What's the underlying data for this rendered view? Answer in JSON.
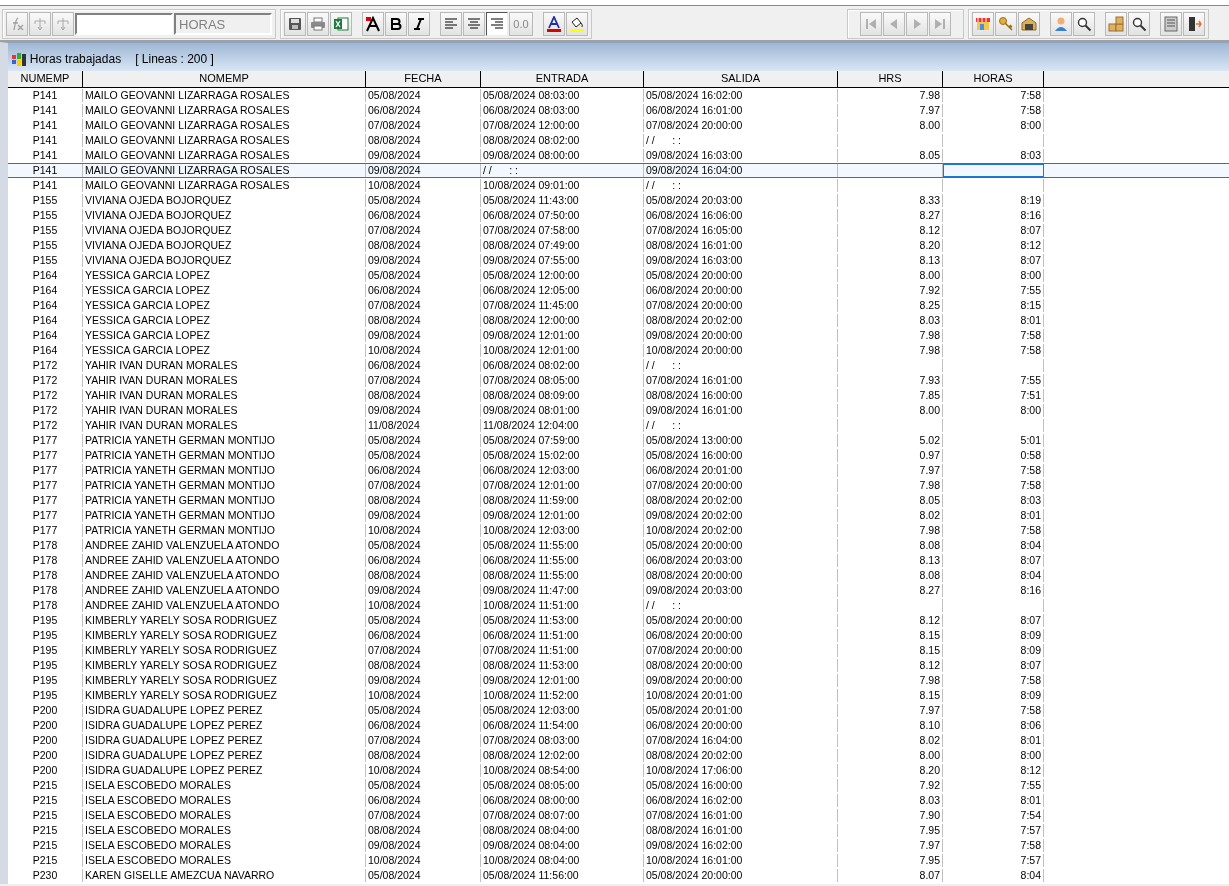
{
  "toolbar": {
    "function_buttons": [
      {
        "disabled": true
      },
      {
        "disabled": true
      },
      {
        "disabled": true
      }
    ],
    "table_field": {
      "value": "HORAS"
    },
    "alignment_buttons": [
      {
        "selected": false
      },
      {
        "selected": false
      },
      {
        "selected": true
      }
    ],
    "precision_button": {
      "label": "0.0",
      "disabled": true
    },
    "nav_buttons": [
      {
        "disabled": true
      },
      {
        "disabled": true
      },
      {
        "disabled": true
      },
      {
        "disabled": true
      }
    ]
  },
  "window": {
    "title": "Horas trabajadas",
    "line_count": "[ Lineas : 200 ]"
  },
  "table": {
    "columns": [
      "NUMEMP",
      "NOMEMP",
      "FECHA",
      "ENTRADA",
      "SALIDA",
      "HRS",
      "HORAS"
    ],
    "rows": [
      {
        "selected": false,
        "cells": [
          "P141",
          "MAILO GEOVANNI LIZARRAGA ROSALES",
          "05/08/2024",
          "05/08/2024 08:03:00",
          "05/08/2024 16:02:00",
          "7.98",
          "7:58"
        ]
      },
      {
        "selected": false,
        "cells": [
          "P141",
          "MAILO GEOVANNI LIZARRAGA ROSALES",
          "06/08/2024",
          "06/08/2024 08:03:00",
          "06/08/2024 16:01:00",
          "7.97",
          "7:58"
        ]
      },
      {
        "selected": false,
        "cells": [
          "P141",
          "MAILO GEOVANNI LIZARRAGA ROSALES",
          "07/08/2024",
          "07/08/2024 12:00:00",
          "07/08/2024 20:00:00",
          "8.00",
          "8:00"
        ]
      },
      {
        "selected": false,
        "cells": [
          "P141",
          "MAILO GEOVANNI LIZARRAGA ROSALES",
          "08/08/2024",
          "08/08/2024 08:02:00",
          "/ /      : :"
        ]
      },
      {
        "selected": false,
        "cells": [
          "P141",
          "MAILO GEOVANNI LIZARRAGA ROSALES",
          "09/08/2024",
          "09/08/2024 08:00:00",
          "09/08/2024 16:03:00",
          "8.05",
          "8:03"
        ]
      },
      {
        "selected": true,
        "cells": [
          "P141",
          "MAILO GEOVANNI LIZARRAGA ROSALES",
          "09/08/2024",
          "/ /      : :",
          "09/08/2024 16:04:00"
        ]
      },
      {
        "selected": false,
        "cells": [
          "P141",
          "MAILO GEOVANNI LIZARRAGA ROSALES",
          "10/08/2024",
          "10/08/2024 09:01:00",
          "/ /      : :"
        ]
      },
      {
        "selected": false,
        "cells": [
          "P155",
          "VIVIANA OJEDA BOJORQUEZ",
          "05/08/2024",
          "05/08/2024 11:43:00",
          "05/08/2024 20:03:00",
          "8.33",
          "8:19"
        ]
      },
      {
        "selected": false,
        "cells": [
          "P155",
          "VIVIANA OJEDA BOJORQUEZ",
          "06/08/2024",
          "06/08/2024 07:50:00",
          "06/08/2024 16:06:00",
          "8.27",
          "8:16"
        ]
      },
      {
        "selected": false,
        "cells": [
          "P155",
          "VIVIANA OJEDA BOJORQUEZ",
          "07/08/2024",
          "07/08/2024 07:58:00",
          "07/08/2024 16:05:00",
          "8.12",
          "8:07"
        ]
      },
      {
        "selected": false,
        "cells": [
          "P155",
          "VIVIANA OJEDA BOJORQUEZ",
          "08/08/2024",
          "08/08/2024 07:49:00",
          "08/08/2024 16:01:00",
          "8.20",
          "8:12"
        ]
      },
      {
        "selected": false,
        "cells": [
          "P155",
          "VIVIANA OJEDA BOJORQUEZ",
          "09/08/2024",
          "09/08/2024 07:55:00",
          "09/08/2024 16:03:00",
          "8.13",
          "8:07"
        ]
      },
      {
        "selected": false,
        "cells": [
          "P164",
          "YESSICA GARCIA LOPEZ",
          "05/08/2024",
          "05/08/2024 12:00:00",
          "05/08/2024 20:00:00",
          "8.00",
          "8:00"
        ]
      },
      {
        "selected": false,
        "cells": [
          "P164",
          "YESSICA GARCIA LOPEZ",
          "06/08/2024",
          "06/08/2024 12:05:00",
          "06/08/2024 20:00:00",
          "7.92",
          "7:55"
        ]
      },
      {
        "selected": false,
        "cells": [
          "P164",
          "YESSICA GARCIA LOPEZ",
          "07/08/2024",
          "07/08/2024 11:45:00",
          "07/08/2024 20:00:00",
          "8.25",
          "8:15"
        ]
      },
      {
        "selected": false,
        "cells": [
          "P164",
          "YESSICA GARCIA LOPEZ",
          "08/08/2024",
          "08/08/2024 12:00:00",
          "08/08/2024 20:02:00",
          "8.03",
          "8:01"
        ]
      },
      {
        "selected": false,
        "cells": [
          "P164",
          "YESSICA GARCIA LOPEZ",
          "09/08/2024",
          "09/08/2024 12:01:00",
          "09/08/2024 20:00:00",
          "7.98",
          "7:58"
        ]
      },
      {
        "selected": false,
        "cells": [
          "P164",
          "YESSICA GARCIA LOPEZ",
          "10/08/2024",
          "10/08/2024 12:01:00",
          "10/08/2024 20:00:00",
          "7.98",
          "7:58"
        ]
      },
      {
        "selected": false,
        "cells": [
          "P172",
          "YAHIR IVAN DURAN MORALES",
          "06/08/2024",
          "06/08/2024 08:02:00",
          "/ /      : :"
        ]
      },
      {
        "selected": false,
        "cells": [
          "P172",
          "YAHIR IVAN DURAN MORALES",
          "07/08/2024",
          "07/08/2024 08:05:00",
          "07/08/2024 16:01:00",
          "7.93",
          "7:55"
        ]
      },
      {
        "selected": false,
        "cells": [
          "P172",
          "YAHIR IVAN DURAN MORALES",
          "08/08/2024",
          "08/08/2024 08:09:00",
          "08/08/2024 16:00:00",
          "7.85",
          "7:51"
        ]
      },
      {
        "selected": false,
        "cells": [
          "P172",
          "YAHIR IVAN DURAN MORALES",
          "09/08/2024",
          "09/08/2024 08:01:00",
          "09/08/2024 16:01:00",
          "8.00",
          "8:00"
        ]
      },
      {
        "selected": false,
        "cells": [
          "P172",
          "YAHIR IVAN DURAN MORALES",
          "11/08/2024",
          "11/08/2024 12:04:00",
          "/ /      : :"
        ]
      },
      {
        "selected": false,
        "cells": [
          "P177",
          "PATRICIA YANETH GERMAN MONTIJO",
          "05/08/2024",
          "05/08/2024 07:59:00",
          "05/08/2024 13:00:00",
          "5.02",
          "5:01"
        ]
      },
      {
        "selected": false,
        "cells": [
          "P177",
          "PATRICIA YANETH GERMAN MONTIJO",
          "05/08/2024",
          "05/08/2024 15:02:00",
          "05/08/2024 16:00:00",
          "0.97",
          "0:58"
        ]
      },
      {
        "selected": false,
        "cells": [
          "P177",
          "PATRICIA YANETH GERMAN MONTIJO",
          "06/08/2024",
          "06/08/2024 12:03:00",
          "06/08/2024 20:01:00",
          "7.97",
          "7:58"
        ]
      },
      {
        "selected": false,
        "cells": [
          "P177",
          "PATRICIA YANETH GERMAN MONTIJO",
          "07/08/2024",
          "07/08/2024 12:01:00",
          "07/08/2024 20:00:00",
          "7.98",
          "7:58"
        ]
      },
      {
        "selected": false,
        "cells": [
          "P177",
          "PATRICIA YANETH GERMAN MONTIJO",
          "08/08/2024",
          "08/08/2024 11:59:00",
          "08/08/2024 20:02:00",
          "8.05",
          "8:03"
        ]
      },
      {
        "selected": false,
        "cells": [
          "P177",
          "PATRICIA YANETH GERMAN MONTIJO",
          "09/08/2024",
          "09/08/2024 12:01:00",
          "09/08/2024 20:02:00",
          "8.02",
          "8:01"
        ]
      },
      {
        "selected": false,
        "cells": [
          "P177",
          "PATRICIA YANETH GERMAN MONTIJO",
          "10/08/2024",
          "10/08/2024 12:03:00",
          "10/08/2024 20:02:00",
          "7.98",
          "7:58"
        ]
      },
      {
        "selected": false,
        "cells": [
          "P178",
          "ANDREE ZAHID VALENZUELA ATONDO",
          "05/08/2024",
          "05/08/2024 11:55:00",
          "05/08/2024 20:00:00",
          "8.08",
          "8:04"
        ]
      },
      {
        "selected": false,
        "cells": [
          "P178",
          "ANDREE ZAHID VALENZUELA ATONDO",
          "06/08/2024",
          "06/08/2024 11:55:00",
          "06/08/2024 20:03:00",
          "8.13",
          "8:07"
        ]
      },
      {
        "selected": false,
        "cells": [
          "P178",
          "ANDREE ZAHID VALENZUELA ATONDO",
          "08/08/2024",
          "08/08/2024 11:55:00",
          "08/08/2024 20:00:00",
          "8.08",
          "8:04"
        ]
      },
      {
        "selected": false,
        "cells": [
          "P178",
          "ANDREE ZAHID VALENZUELA ATONDO",
          "09/08/2024",
          "09/08/2024 11:47:00",
          "09/08/2024 20:03:00",
          "8.27",
          "8:16"
        ]
      },
      {
        "selected": false,
        "cells": [
          "P178",
          "ANDREE ZAHID VALENZUELA ATONDO",
          "10/08/2024",
          "10/08/2024 11:51:00",
          "/ /      : :"
        ]
      },
      {
        "selected": false,
        "cells": [
          "P195",
          "KIMBERLY YARELY SOSA RODRIGUEZ",
          "05/08/2024",
          "05/08/2024 11:53:00",
          "05/08/2024 20:00:00",
          "8.12",
          "8:07"
        ]
      },
      {
        "selected": false,
        "cells": [
          "P195",
          "KIMBERLY YARELY SOSA RODRIGUEZ",
          "06/08/2024",
          "06/08/2024 11:51:00",
          "06/08/2024 20:00:00",
          "8.15",
          "8:09"
        ]
      },
      {
        "selected": false,
        "cells": [
          "P195",
          "KIMBERLY YARELY SOSA RODRIGUEZ",
          "07/08/2024",
          "07/08/2024 11:51:00",
          "07/08/2024 20:00:00",
          "8.15",
          "8:09"
        ]
      },
      {
        "selected": false,
        "cells": [
          "P195",
          "KIMBERLY YARELY SOSA RODRIGUEZ",
          "08/08/2024",
          "08/08/2024 11:53:00",
          "08/08/2024 20:00:00",
          "8.12",
          "8:07"
        ]
      },
      {
        "selected": false,
        "cells": [
          "P195",
          "KIMBERLY YARELY SOSA RODRIGUEZ",
          "09/08/2024",
          "09/08/2024 12:01:00",
          "09/08/2024 20:00:00",
          "7.98",
          "7:58"
        ]
      },
      {
        "selected": false,
        "cells": [
          "P195",
          "KIMBERLY YARELY SOSA RODRIGUEZ",
          "10/08/2024",
          "10/08/2024 11:52:00",
          "10/08/2024 20:01:00",
          "8.15",
          "8:09"
        ]
      },
      {
        "selected": false,
        "cells": [
          "P200",
          "ISIDRA GUADALUPE LOPEZ PEREZ",
          "05/08/2024",
          "05/08/2024 12:03:00",
          "05/08/2024 20:01:00",
          "7.97",
          "7:58"
        ]
      },
      {
        "selected": false,
        "cells": [
          "P200",
          "ISIDRA GUADALUPE LOPEZ PEREZ",
          "06/08/2024",
          "06/08/2024 11:54:00",
          "06/08/2024 20:00:00",
          "8.10",
          "8:06"
        ]
      },
      {
        "selected": false,
        "cells": [
          "P200",
          "ISIDRA GUADALUPE LOPEZ PEREZ",
          "07/08/2024",
          "07/08/2024 08:03:00",
          "07/08/2024 16:04:00",
          "8.02",
          "8:01"
        ]
      },
      {
        "selected": false,
        "cells": [
          "P200",
          "ISIDRA GUADALUPE LOPEZ PEREZ",
          "08/08/2024",
          "08/08/2024 12:02:00",
          "08/08/2024 20:02:00",
          "8.00",
          "8:00"
        ]
      },
      {
        "selected": false,
        "cells": [
          "P200",
          "ISIDRA GUADALUPE LOPEZ PEREZ",
          "10/08/2024",
          "10/08/2024 08:54:00",
          "10/08/2024 17:06:00",
          "8.20",
          "8:12"
        ]
      },
      {
        "selected": false,
        "cells": [
          "P215",
          "ISELA ESCOBEDO MORALES",
          "05/08/2024",
          "05/08/2024 08:05:00",
          "05/08/2024 16:00:00",
          "7.92",
          "7:55"
        ]
      },
      {
        "selected": false,
        "cells": [
          "P215",
          "ISELA ESCOBEDO MORALES",
          "06/08/2024",
          "06/08/2024 08:00:00",
          "06/08/2024 16:02:00",
          "8.03",
          "8:01"
        ]
      },
      {
        "selected": false,
        "cells": [
          "P215",
          "ISELA ESCOBEDO MORALES",
          "07/08/2024",
          "07/08/2024 08:07:00",
          "07/08/2024 16:01:00",
          "7.90",
          "7:54"
        ]
      },
      {
        "selected": false,
        "cells": [
          "P215",
          "ISELA ESCOBEDO MORALES",
          "08/08/2024",
          "08/08/2024 08:04:00",
          "08/08/2024 16:01:00",
          "7.95",
          "7:57"
        ]
      },
      {
        "selected": false,
        "cells": [
          "P215",
          "ISELA ESCOBEDO MORALES",
          "09/08/2024",
          "09/08/2024 08:04:00",
          "09/08/2024 16:02:00",
          "7.97",
          "7:58"
        ]
      },
      {
        "selected": false,
        "cells": [
          "P215",
          "ISELA ESCOBEDO MORALES",
          "10/08/2024",
          "10/08/2024 08:04:00",
          "10/08/2024 16:01:00",
          "7.95",
          "7:57"
        ]
      },
      {
        "selected": false,
        "cells": [
          "P230",
          "KAREN GISELLE AMEZCUA NAVARRO",
          "05/08/2024",
          "05/08/2024 11:56:00",
          "05/08/2024 20:00:00",
          "8.07",
          "8:04"
        ]
      }
    ]
  }
}
